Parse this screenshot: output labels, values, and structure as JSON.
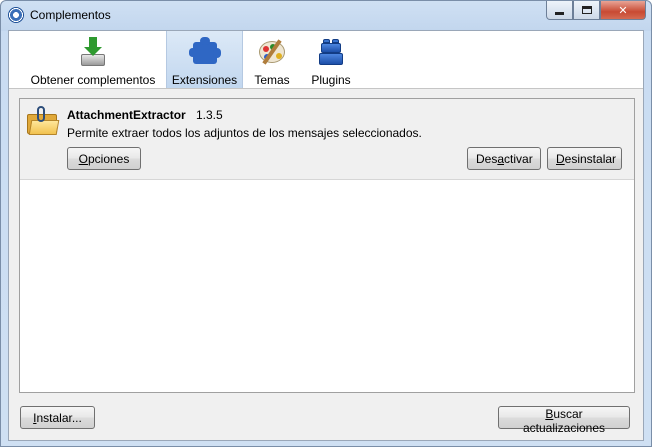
{
  "window": {
    "title": "Complementos",
    "controls": {
      "minimize": "minimize",
      "maximize": "maximize",
      "close": "✕"
    }
  },
  "tabs": [
    {
      "label": "Obtener complementos",
      "icon": "download-icon",
      "selected": false
    },
    {
      "label": "Extensiones",
      "icon": "puzzle-icon",
      "selected": true
    },
    {
      "label": "Temas",
      "icon": "palette-icon",
      "selected": false
    },
    {
      "label": "Plugins",
      "icon": "plugin-blocks-icon",
      "selected": false
    }
  ],
  "extension": {
    "name": "AttachmentExtractor",
    "version": "1.3.5",
    "description": "Permite extraer todos los adjuntos de los mensajes seleccionados.",
    "icon": "folder-paperclip-icon",
    "buttons": {
      "options": {
        "pre": "",
        "accel": "O",
        "post": "pciones"
      },
      "disable": {
        "pre": "Des",
        "accel": "a",
        "post": "ctivar"
      },
      "uninstall": {
        "pre": "",
        "accel": "D",
        "post": "esinstalar"
      }
    }
  },
  "footer": {
    "install": {
      "pre": "",
      "accel": "I",
      "post": "nstalar..."
    },
    "check_updates": {
      "pre": "",
      "accel": "B",
      "post": "uscar actualizaciones"
    }
  },
  "colors": {
    "selected_tab": "#c2d7ef",
    "window_frame": "#c9dcf2",
    "close_button": "#c84a33",
    "puzzle_blue": "#2f67c4"
  }
}
